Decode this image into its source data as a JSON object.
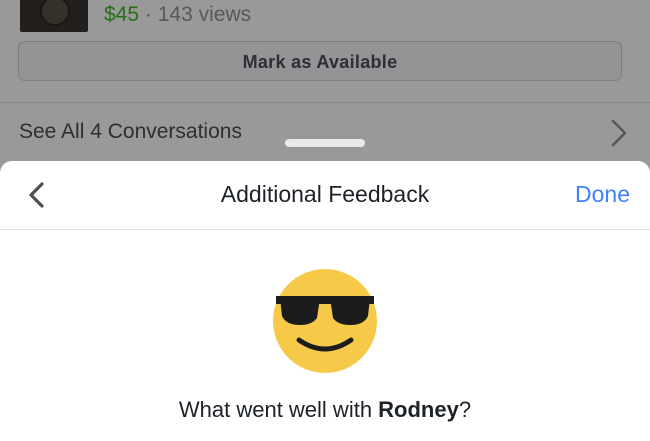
{
  "listing": {
    "price": "$45",
    "separator": "·",
    "views": "143 views",
    "mark_available_label": "Mark as Available",
    "conversations_label": "See All 4 Conversations"
  },
  "sheet": {
    "title": "Additional Feedback",
    "done_label": "Done",
    "question_prefix": "What went well with ",
    "question_name": "Rodney",
    "question_suffix": "?",
    "icons": {
      "back": "chevron-left-icon",
      "emoji": "sunglasses-emoji-icon",
      "conversations": "chevron-right-icon"
    }
  },
  "colors": {
    "price": "#42b72a",
    "accent": "#4080ff",
    "emoji_face": "#f7c948"
  }
}
